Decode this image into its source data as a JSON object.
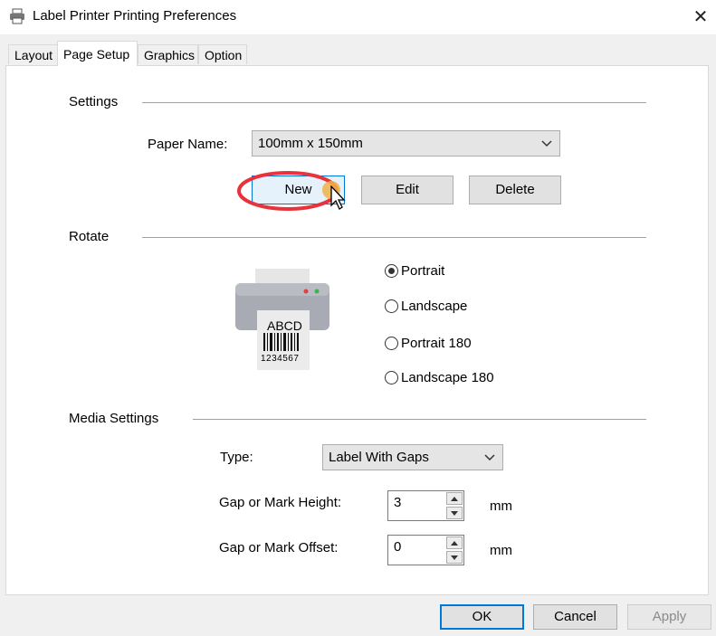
{
  "window": {
    "title": "Label Printer Printing Preferences",
    "close_glyph": "✕"
  },
  "tabs": [
    {
      "label": "Layout",
      "active": false
    },
    {
      "label": "Page Setup",
      "active": true
    },
    {
      "label": "Graphics",
      "active": false
    },
    {
      "label": "Option",
      "active": false
    }
  ],
  "settings": {
    "heading": "Settings",
    "paper_name_label": "Paper Name:",
    "paper_name_value": "100mm x 150mm",
    "new_label": "New",
    "edit_label": "Edit",
    "delete_label": "Delete"
  },
  "rotate": {
    "heading": "Rotate",
    "label_sample_text": "ABCD",
    "label_sample_number": "1234567",
    "options": [
      {
        "label": "Portrait",
        "selected": true
      },
      {
        "label": "Landscape",
        "selected": false
      },
      {
        "label": "Portrait 180",
        "selected": false
      },
      {
        "label": "Landscape 180",
        "selected": false
      }
    ]
  },
  "media": {
    "heading": "Media Settings",
    "type_label": "Type:",
    "type_value": "Label With Gaps",
    "gap_height_label": "Gap or Mark Height:",
    "gap_height_value": "3",
    "gap_height_unit": "mm",
    "gap_offset_label": "Gap or Mark Offset:",
    "gap_offset_value": "0",
    "gap_offset_unit": "mm"
  },
  "footer": {
    "ok_label": "OK",
    "cancel_label": "Cancel",
    "apply_label": "Apply"
  },
  "colors": {
    "highlight_circle": "#e8323c",
    "cursor_halo": "#f0b24a",
    "new_button_bg": "#e5f1fb",
    "new_button_border": "#0078d7",
    "ok_border": "#0078d7"
  }
}
